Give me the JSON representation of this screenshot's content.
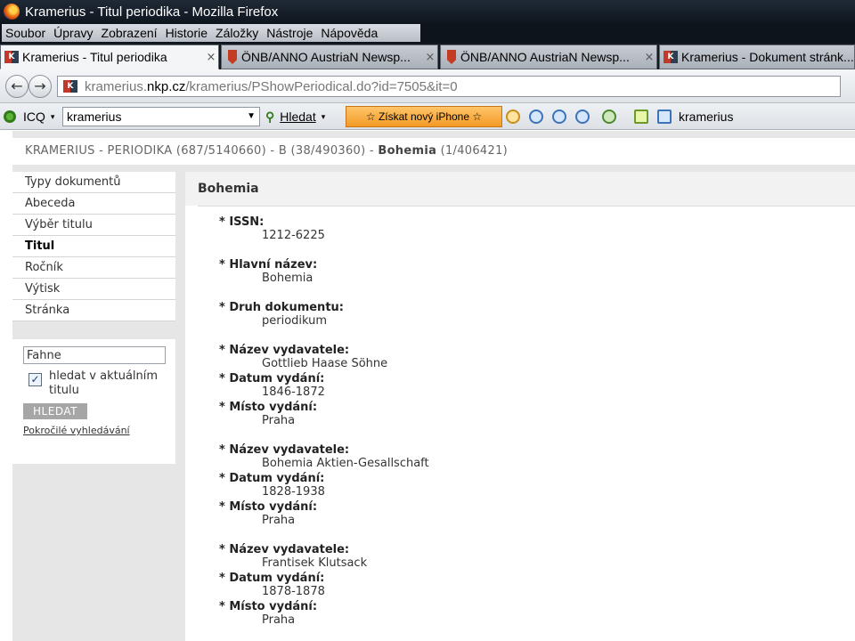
{
  "window": {
    "title": "Kramerius - Titul periodika - Mozilla Firefox"
  },
  "menu": [
    "Soubor",
    "Úpravy",
    "Zobrazení",
    "Historie",
    "Záložky",
    "Nástroje",
    "Nápověda"
  ],
  "tabs": [
    {
      "label": "Kramerius - Titul periodika",
      "favicon": "kramerius-favicon",
      "active": true
    },
    {
      "label": "ÖNB/ANNO AustriaN Newsp...",
      "favicon": "onb-favicon",
      "active": false
    },
    {
      "label": "ÖNB/ANNO AustriaN Newsp...",
      "favicon": "onb-favicon",
      "active": false
    },
    {
      "label": "Kramerius - Dokument stránk...",
      "favicon": "kramerius-favicon",
      "active": false
    }
  ],
  "tab_close_glyph": "×",
  "nav": {
    "back_icon": "back-arrow-icon",
    "forward_icon": "forward-arrow-icon",
    "url_prefix": "kramerius.",
    "url_host": "nkp.cz",
    "url_path": "/kramerius/PShowPeriodical.do?id=7505&it=0"
  },
  "search_toolbar": {
    "icq_label": "ICQ",
    "search_value": "kramerius",
    "hledat_label": "Hledat",
    "promo_label": "☆ Získat nový iPhone ☆",
    "right_label": "kramerius"
  },
  "breadcrumb": {
    "part1": "KRAMERIUS - PERIODIKA (687/5140660) - B (38/490360) - ",
    "current": "Bohemia",
    "count": " (1/406421)"
  },
  "sidebar": {
    "items": [
      {
        "label": "Typy dokumentů",
        "active": false
      },
      {
        "label": "Abeceda",
        "active": false
      },
      {
        "label": "Výběr titulu",
        "active": false
      },
      {
        "label": "Titul",
        "active": true
      },
      {
        "label": "Ročník",
        "active": false
      },
      {
        "label": "Výtisk",
        "active": false
      },
      {
        "label": "Stránka",
        "active": false
      }
    ],
    "search_value": "Fahne",
    "checkbox_label": "hledat v aktuálním titulu",
    "checkbox_checked": true,
    "search_button": "HLEDAT",
    "advanced_link": "Pokročilé vyhledávání"
  },
  "content": {
    "title": "Bohemia",
    "fields": [
      {
        "label": "* ISSN:",
        "value": "1212-6225"
      },
      {
        "label": "* Hlavní název:",
        "value": "Bohemia"
      },
      {
        "label": "* Druh dokumentu:",
        "value": "periodikum"
      },
      {
        "label": "* Název vydavatele:",
        "value": "Gottlieb Haase Söhne"
      },
      {
        "label": "* Datum vydání:",
        "value": "1846-1872"
      },
      {
        "label": "* Místo vydání:",
        "value": "Praha"
      },
      {
        "label": "* Název vydavatele:",
        "value": "Bohemia Aktien-Gesallschaft"
      },
      {
        "label": "* Datum vydání:",
        "value": "1828-1938"
      },
      {
        "label": "* Místo vydání:",
        "value": "Praha"
      },
      {
        "label": "* Název vydavatele:",
        "value": "Frantisek Klutsack"
      },
      {
        "label": "* Datum vydání:",
        "value": "1878-1878"
      },
      {
        "label": "* Místo vydání:",
        "value": "Praha"
      }
    ]
  }
}
